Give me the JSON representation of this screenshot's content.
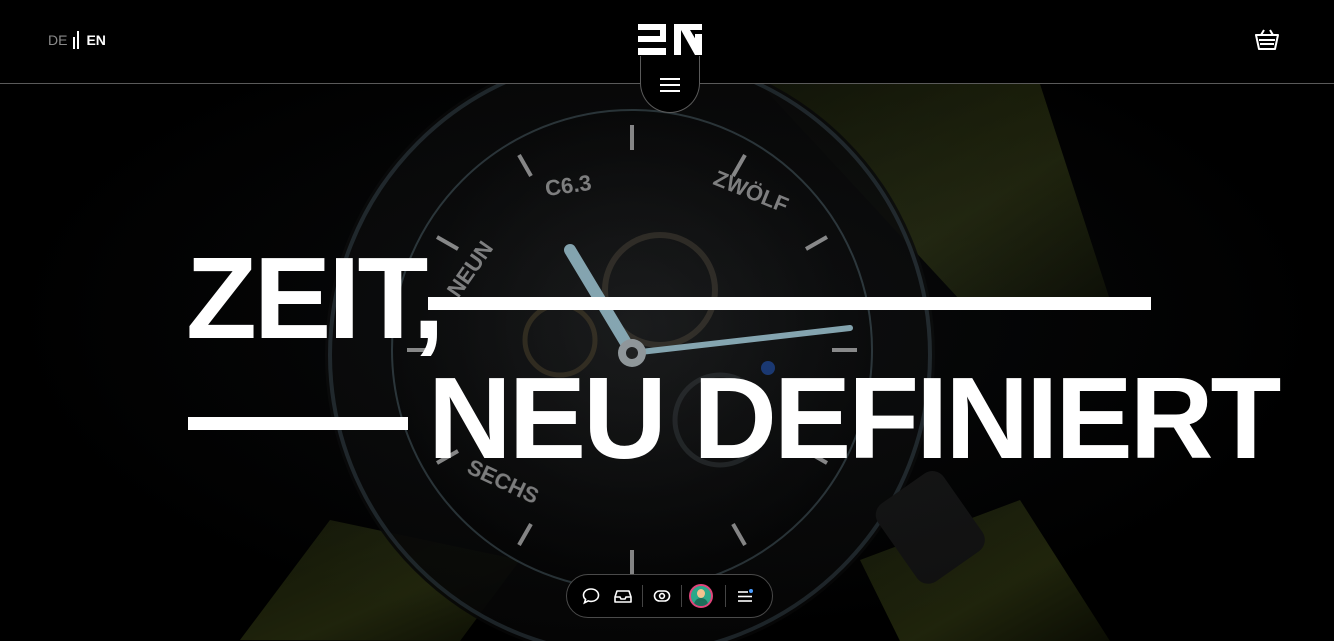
{
  "header": {
    "lang_de": "DE",
    "lang_en": "EN",
    "logo_alt": "BN"
  },
  "hero": {
    "headline_line1": "ZEIT,",
    "headline_line2": "NEU DEFINIERT",
    "dial_labels": [
      "C6.3",
      "ZWÖLF",
      "NEUN",
      "SECHS"
    ]
  },
  "toolbar": {
    "items": [
      "chat-icon",
      "inbox-icon",
      "eye-icon",
      "avatar",
      "menu-dot-icon"
    ]
  },
  "colors": {
    "background": "#000000",
    "text": "#ffffff",
    "strap": "#6b7a2a",
    "lume": "#9fe8ff",
    "avatar_ring": "#e0457b",
    "avatar_bg": "#2aa98a"
  }
}
